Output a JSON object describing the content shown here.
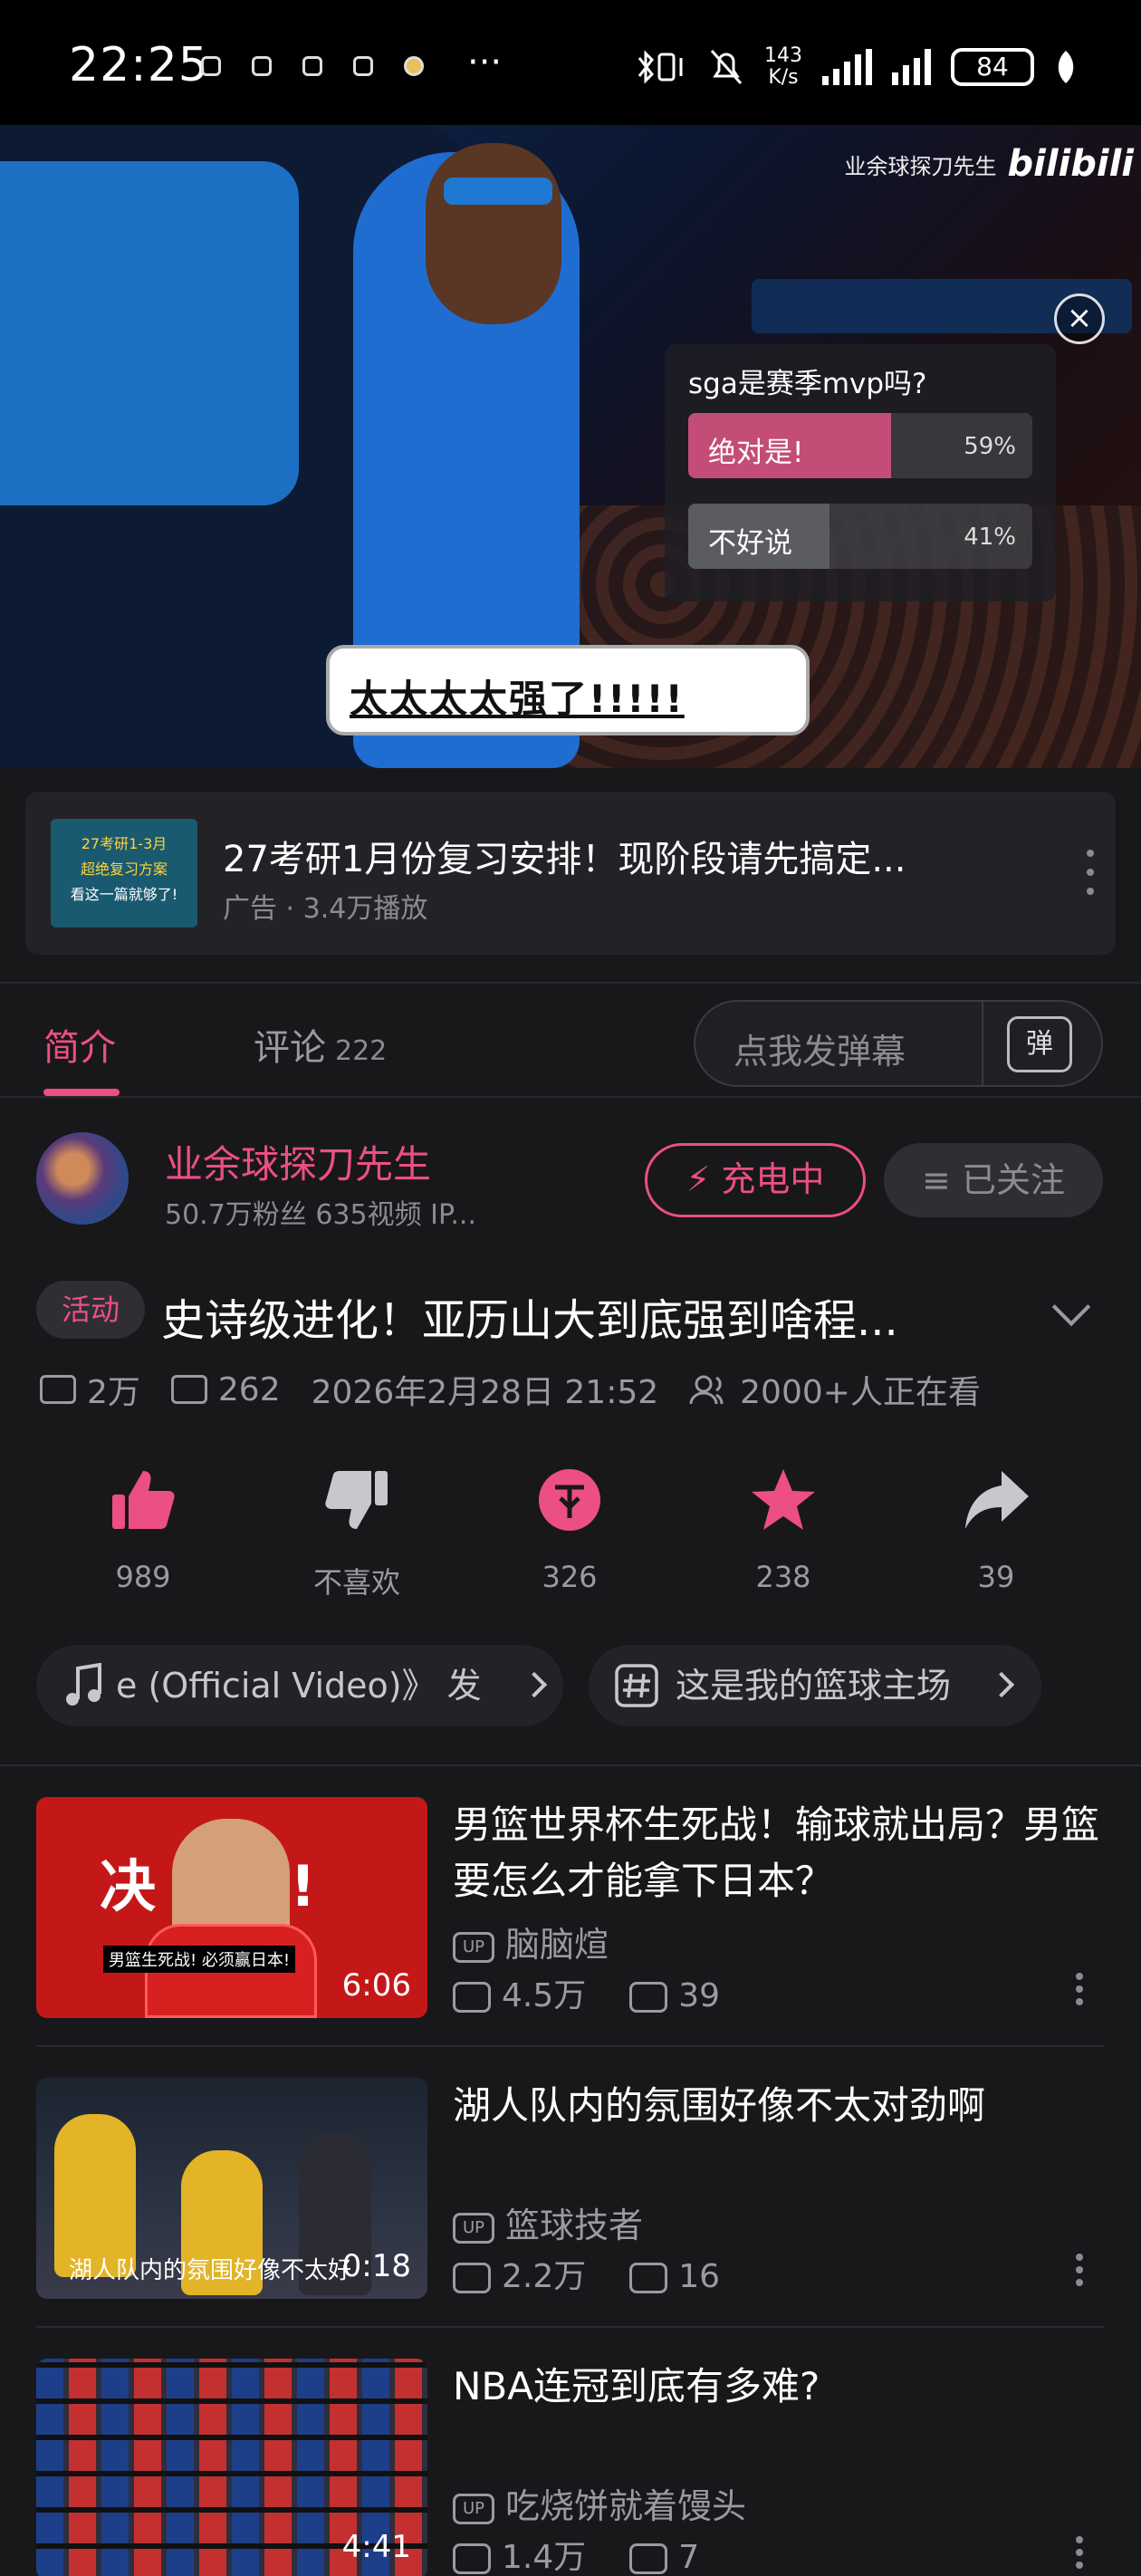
{
  "status_bar": {
    "time": "22:25",
    "dots": "···",
    "net_speed_value": "143",
    "net_speed_unit": "K/s",
    "battery": "84"
  },
  "player": {
    "watermark": "业余球探刀先生",
    "watermark_logo": "bilibili",
    "poll": {
      "question": "sga是赛季mvp吗?",
      "options": [
        {
          "label": "绝对是!",
          "percent": "59%",
          "value": 0.59,
          "color": "#c44d78"
        },
        {
          "label": "不好说",
          "percent": "41%",
          "value": 0.41,
          "color": "#5b5b62"
        }
      ]
    },
    "sticker_text": "太太太太强了!!!!!"
  },
  "ad": {
    "thumb_lines": [
      "27考研1-3月",
      "超绝复习方案",
      "看这一篇就够了!"
    ],
    "title": "27考研1月份复习安排！现阶段请先搞定...",
    "meta": "广告 · 3.4万播放"
  },
  "tabs": {
    "intro": "简介",
    "comments": "评论",
    "comments_count": "222",
    "danmu_placeholder": "点我发弹幕",
    "danmu_button": "弹"
  },
  "uploader": {
    "name": "业余球探刀先生",
    "meta": "50.7万粉丝    635视频    IP...",
    "charge_label": "⚡ 充电中",
    "follow_label": "≡ 已关注"
  },
  "video": {
    "tag": "活动",
    "title": "史诗级进化！亚历山大到底强到啥程...",
    "views": "2万",
    "danmaku": "262",
    "date": "2026年2月28日 21:52",
    "watching": "2000+人正在看"
  },
  "actions": [
    {
      "icon": "thumbs-up-icon",
      "label": "989"
    },
    {
      "icon": "thumbs-down-icon",
      "label": "不喜欢"
    },
    {
      "icon": "coin-icon",
      "label": "326"
    },
    {
      "icon": "star-icon",
      "label": "238"
    },
    {
      "icon": "share-icon",
      "label": "39"
    }
  ],
  "chips": [
    {
      "icon": "music-icon",
      "text": "e (Official Video)》  发"
    },
    {
      "icon": "hashtag-icon",
      "text": "这是我的篮球主场"
    }
  ],
  "recommendations": [
    {
      "title": "男篮世界杯生死战！输球就出局？男篮要怎么才能拿下日本？",
      "uploader": "脑脑煊",
      "views": "4.5万",
      "danmaku": "39",
      "duration": "6:06",
      "thumb_text_big": "决    战!",
      "thumb_caption": "男篮生死战! 必须赢日本!"
    },
    {
      "title": "湖人队内的氛围好像不太对劲啊",
      "uploader": "篮球技者",
      "views": "2.2万",
      "danmaku": "16",
      "duration": "0:18",
      "thumb_caption": "湖人队内的氛围好像不太好"
    },
    {
      "title": "NBA连冠到底有多难?",
      "uploader": "吃烧饼就着馒头",
      "views": "1.4万",
      "danmaku": "7",
      "duration": "4:41"
    }
  ],
  "colors": {
    "accent": "#ec4f84",
    "background": "#18181b",
    "muted": "#9a9aa0"
  }
}
